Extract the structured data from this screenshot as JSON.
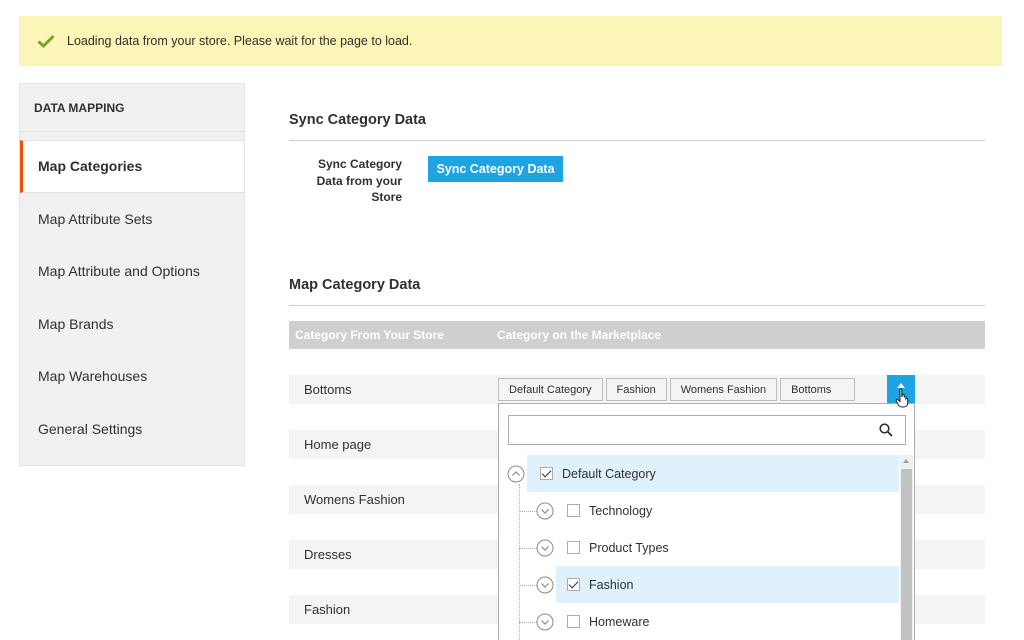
{
  "notice": {
    "message": "Loading data from your store. Please wait for the page to load."
  },
  "sidebar": {
    "section_title": "DATA MAPPING",
    "items": [
      {
        "label": "Map Categories"
      },
      {
        "label": "Map Attribute Sets"
      },
      {
        "label": "Map Attribute and Options"
      },
      {
        "label": "Map Brands"
      },
      {
        "label": "Map Warehouses"
      },
      {
        "label": "General Settings"
      }
    ]
  },
  "sync": {
    "heading": "Sync Category Data",
    "field_label": "Sync Category Data from your Store",
    "button_label": "Sync Category Data"
  },
  "map": {
    "heading": "Map Category Data",
    "col_store": "Category From Your Store",
    "col_marketplace": "Category on the Marketplace",
    "rows": [
      {
        "label": "Bottoms"
      },
      {
        "label": "Home page"
      },
      {
        "label": "Womens Fashion"
      },
      {
        "label": "Dresses"
      },
      {
        "label": "Fashion"
      }
    ],
    "selected_path": [
      "Default Category",
      "Fashion",
      "Womens Fashion",
      "Bottoms"
    ]
  },
  "dropdown": {
    "search_value": "",
    "tree": [
      {
        "label": "Default Category",
        "checked": true
      },
      {
        "label": "Technology",
        "checked": false
      },
      {
        "label": "Product Types",
        "checked": false
      },
      {
        "label": "Fashion",
        "checked": true
      },
      {
        "label": "Homeware",
        "checked": false
      }
    ]
  },
  "colors": {
    "accent": "#1ea3e3",
    "active_border": "#eb5202",
    "notice_bg": "#fbf6b7"
  },
  "icons": {
    "notice": "check-icon",
    "search": "search-icon",
    "toggle": "chevron-up-circle-icon"
  }
}
